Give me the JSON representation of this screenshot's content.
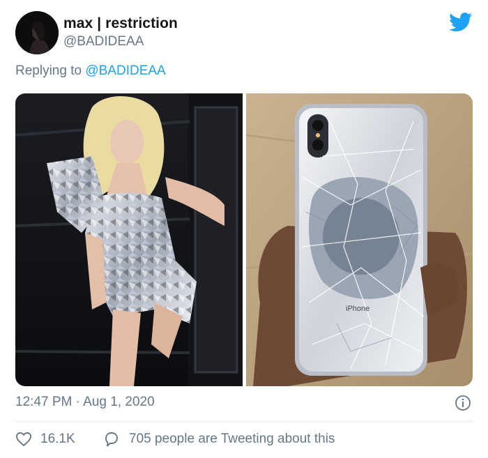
{
  "tweet": {
    "author_name": "max | restriction",
    "author_handle": "@BADIDEAA",
    "reply_prefix": "Replying to ",
    "reply_mention": "@BADIDEAA",
    "timestamp": "12:47 PM · Aug 1, 2020",
    "likes": "16.1K",
    "tweeting_about": "705 people are Tweeting about this",
    "phone_brand_text": "iPhone"
  },
  "icons": {
    "logo": "twitter-bird-icon",
    "info": "info-icon",
    "like": "heart-icon",
    "reply": "speech-bubble-icon"
  },
  "colors": {
    "accent": "#1da1f2",
    "secondary_text": "#657786",
    "primary_text": "#14171a",
    "divider": "#e1e8ed"
  }
}
